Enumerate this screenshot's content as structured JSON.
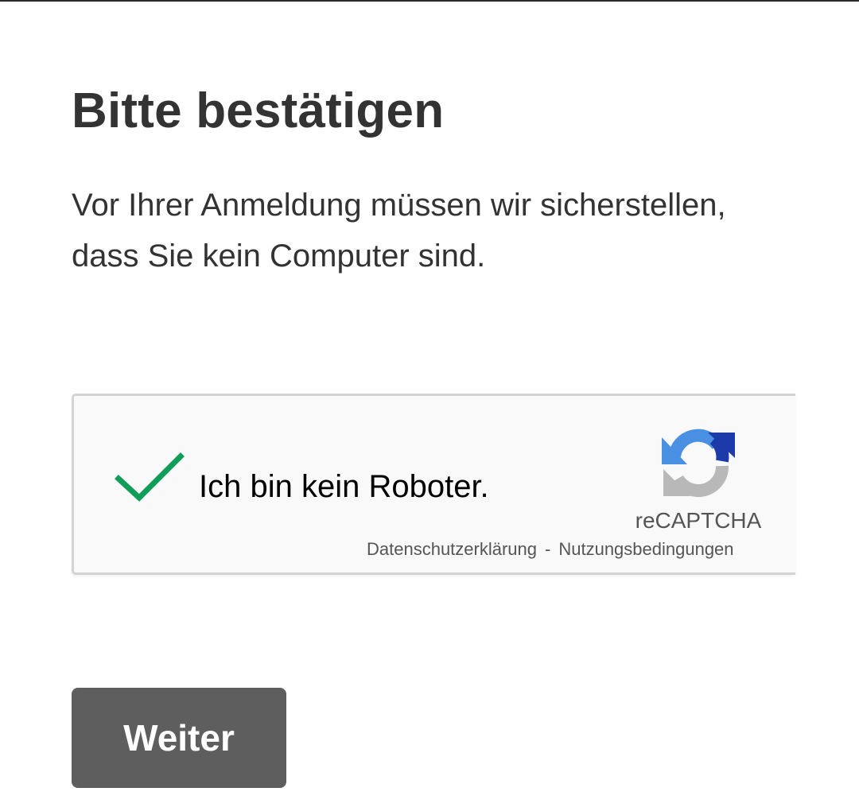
{
  "page": {
    "title": "Bitte bestätigen",
    "intro_line1": "Vor Ihrer Anmeldung müssen wir sicherstellen,",
    "intro_line2": "dass Sie kein Computer sind."
  },
  "recaptcha": {
    "checkbox_label": "Ich bin kein Roboter.",
    "checked": true,
    "brand": "reCAPTCHA",
    "privacy_link": "Datenschutzerklärung",
    "separator": "-",
    "terms_link": "Nutzungsbedingungen",
    "icons": {
      "check": "checkmark-icon",
      "logo": "recaptcha-logo-icon"
    },
    "colors": {
      "check": "#0f9d58",
      "logo_blue": "#4a90e2",
      "logo_dark_blue": "#1c3aa9",
      "logo_gray": "#b8b8b8"
    }
  },
  "actions": {
    "continue_label": "Weiter"
  }
}
